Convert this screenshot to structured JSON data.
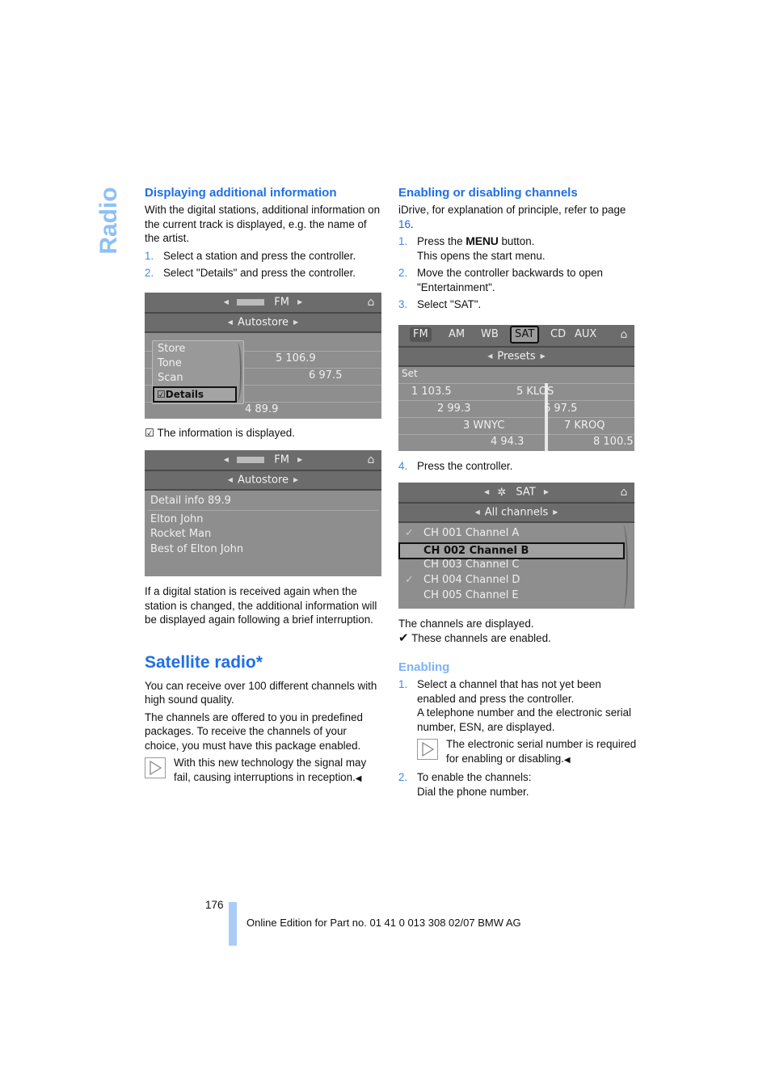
{
  "side_title": "Radio",
  "left": {
    "section1": {
      "heading": "Displaying additional information",
      "intro": "With the digital stations, additional information on the current track is displayed, e.g. the name of the artist.",
      "steps": [
        {
          "num": "1.",
          "text": "Select a station and press the controller."
        },
        {
          "num": "2.",
          "text": "Select \"Details\" and press the controller."
        }
      ]
    },
    "screen1": {
      "top_bar": "FM",
      "sub_bar": "Autostore",
      "menu_items": [
        "Store",
        "Tone",
        "Scan"
      ],
      "menu_selected": "Details",
      "stations": [
        "5 106.9",
        "6 97.5",
        "4 89.9"
      ]
    },
    "info_caption": "The information is displayed.",
    "screen2": {
      "top_bar": "FM",
      "sub_bar": "Autostore",
      "detail_header": "Detail info 89.9",
      "lines": [
        "Elton John",
        "Rocket Man",
        "Best of Elton John"
      ]
    },
    "after_text": "If a digital station is received again when the station is changed, the additional information will be displayed again following a brief interruption.",
    "section2": {
      "heading": "Satellite radio*",
      "para1": "You can receive over 100 different channels with high sound quality.",
      "para2": "The channels are offered to you in predefined packages. To receive the channels of your choice, you must have this package enabled.",
      "note": "With this new technology the signal may fail, causing interruptions in reception."
    }
  },
  "right": {
    "heading": "Enabling or disabling channels",
    "intro_prefix": "iDrive, for explanation of principle, refer to page ",
    "intro_link": "16",
    "intro_suffix": ".",
    "steps": [
      {
        "num": "1.",
        "pre": "Press the ",
        "menu": "MENU",
        "post": " button.",
        "sub": "This opens the start menu."
      },
      {
        "num": "2.",
        "text": "Move the controller backwards to open \"Entertainment\"."
      },
      {
        "num": "3.",
        "text": "Select \"SAT\"."
      }
    ],
    "screen3": {
      "tabs": [
        "FM",
        "AM",
        "WB",
        "SAT",
        "CD",
        "AUX"
      ],
      "active_tab": "SAT",
      "sub_bar": "Presets",
      "set_label": "Set",
      "presets_left": [
        "1 103.5",
        "2 99.3",
        "3 WNYC",
        "4 94.3"
      ],
      "presets_right": [
        "5 KLOS",
        "6 97.5",
        "7 KROQ",
        "8 100.5"
      ]
    },
    "step4": {
      "num": "4.",
      "text": "Press the controller."
    },
    "screen4": {
      "top_bar": "SAT",
      "sub_bar": "All channels",
      "channels": [
        {
          "label": "CH 001 Channel A",
          "enabled": true
        },
        {
          "label": "CH 002 Channel B",
          "enabled": false,
          "selected": true
        },
        {
          "label": "CH 003 Channel C",
          "enabled": false
        },
        {
          "label": "CH 004 Channel D",
          "enabled": true
        },
        {
          "label": "CH 005 Channel E",
          "enabled": false
        }
      ]
    },
    "channels_caption": "The channels are displayed.",
    "enabled_caption": "These channels are enabled.",
    "enabling": {
      "heading": "Enabling",
      "step1_num": "1.",
      "step1_text": "Select a channel that has not yet been enabled and press the controller.",
      "step1_sub": "A telephone number and the electronic serial number, ESN, are displayed.",
      "note": "The electronic serial number is required for enabling or disabling.",
      "step2_num": "2.",
      "step2_text": "To enable the channels:",
      "step2_sub": "Dial the phone number."
    }
  },
  "footer": {
    "page_number": "176",
    "edition": "Online Edition for Part no. 01 41 0 013 308 02/07 BMW AG"
  }
}
